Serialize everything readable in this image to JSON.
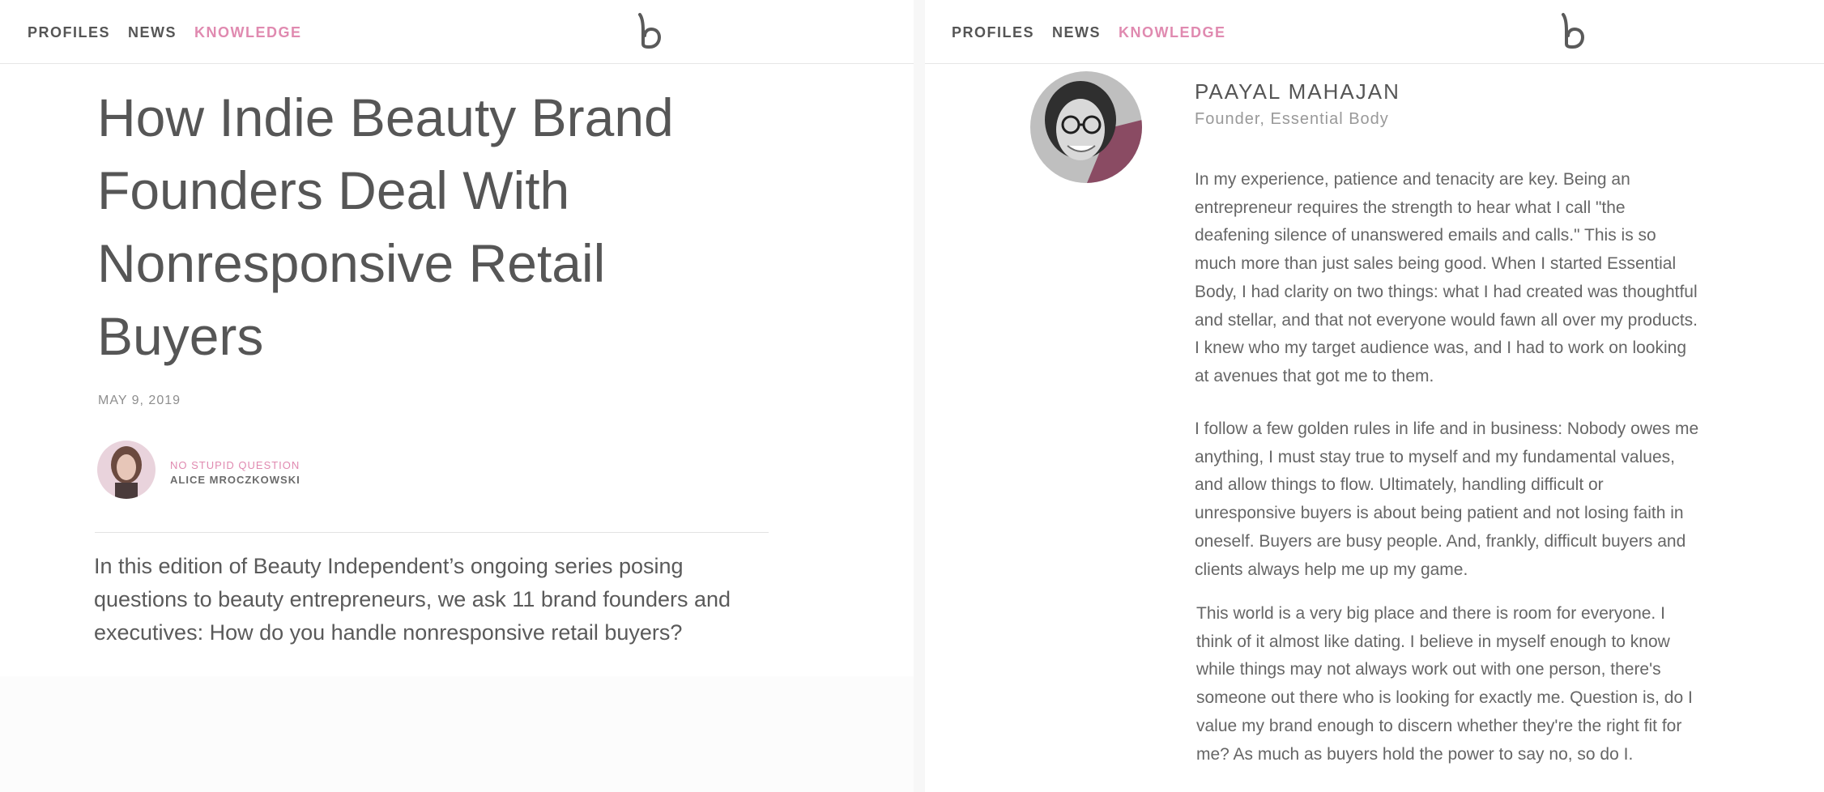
{
  "nav": {
    "items": [
      {
        "label": "PROFILES"
      },
      {
        "label": "NEWS"
      },
      {
        "label": "KNOWLEDGE"
      }
    ],
    "active": "KNOWLEDGE",
    "logo_icon": "beauty-independent-b-logo-icon"
  },
  "article": {
    "title": "How Indie Beauty Brand Founders Deal With Nonresponsive Retail Buyers",
    "date": "MAY 9, 2019",
    "series": "NO STUPID QUESTION",
    "author": "ALICE MROCZKOWSKI",
    "intro": "In this edition of Beauty Independent’s ongoing series posing questions to beauty entrepreneurs, we ask 11 brand founders and executives: How do you handle nonresponsive retail buyers?"
  },
  "profile": {
    "name": "PAAYAL MAHAJAN",
    "role": "Founder, Essential Body",
    "paragraphs": [
      "In my experience, patience and tenacity are key. Being an entrepreneur requires the strength to hear what I call \"the deafening silence of unanswered emails and calls.\" This is so much more than just sales being good. When I started Essential Body, I had clarity on two things: what I had created was thoughtful and stellar, and that not everyone would fawn all over my products. I knew who my target audience was, and I had to work on looking at avenues that got me to them.",
      "I follow a few golden rules in life and in business: Nobody owes me anything, I must stay true to myself and my fundamental values, and allow things to flow. Ultimately, handling difficult or unresponsive buyers is about being patient and not losing faith in oneself. Buyers are busy people. And, frankly, difficult buyers and clients always help me up my game.",
      "This world is a very big place and there is room for everyone. I think of it almost like dating. I believe in myself enough to know while things may not always work out with one person, there's someone out there who is looking for exactly me. Question is, do I value my brand enough to discern whether they're the right fit for me? As much as buyers hold the power to say no, so do I."
    ]
  },
  "colors": {
    "accent_pink": "#e08ab0",
    "text_gray": "#555555",
    "muted_gray": "#999999"
  }
}
